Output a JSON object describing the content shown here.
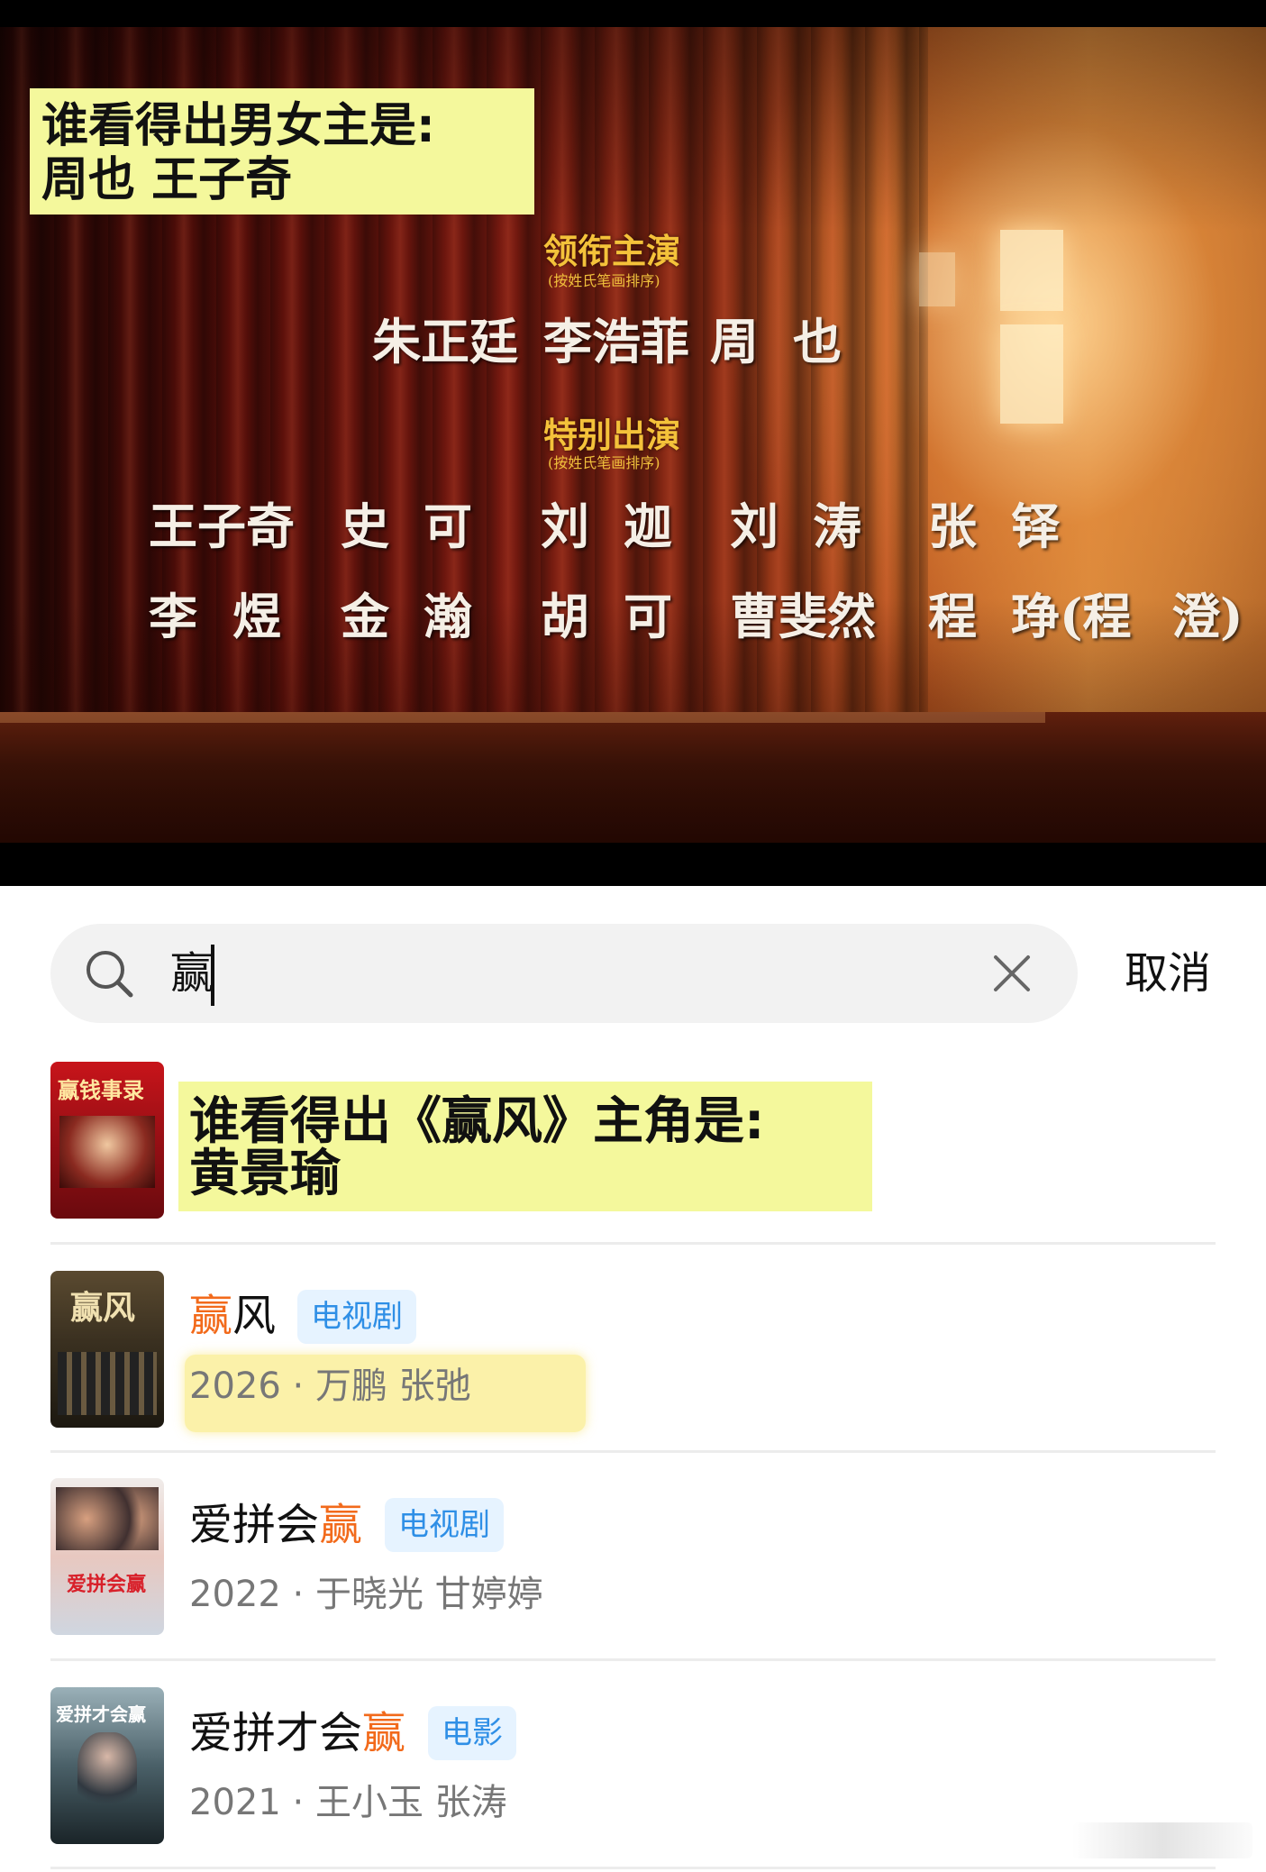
{
  "video": {
    "caption": {
      "line1": "谁看得出男女主是:",
      "line2": "周也 王子奇"
    },
    "credits": {
      "lead_heading": "领衔主演",
      "lead_note": "(按姓氏笔画排序)",
      "lead_names": [
        "朱正廷",
        "李浩菲",
        "周",
        "也"
      ],
      "special_heading": "特别出演",
      "special_note": "(按姓氏笔画排序)",
      "special_row1": [
        "王子奇",
        "史",
        "可",
        "刘",
        "迦",
        "刘",
        "涛",
        "张",
        "铎"
      ],
      "special_row2": [
        "李",
        "煜",
        "金",
        "瀚",
        "胡",
        "可",
        "曹斐然",
        "程",
        "琤(程",
        "澄)"
      ]
    }
  },
  "search": {
    "query": "赢",
    "clear_icon": "close-icon",
    "cancel_label": "取消"
  },
  "results": [
    {
      "poster_text": "赢钱事录",
      "highlight_line1": "谁看得出《赢风》主角是:",
      "highlight_line2": "黄景瑜"
    },
    {
      "poster_text": "赢风",
      "title_highlight": "赢",
      "title_rest": "风",
      "tag": "电视剧",
      "meta": "2026 · 万鹏 张弛"
    },
    {
      "poster_text": "爱拼会赢",
      "title_before": "爱拼会",
      "title_highlight": "赢",
      "tag": "电视剧",
      "meta": "2022 · 于晓光 甘婷婷"
    },
    {
      "poster_text": "爱拼才会赢",
      "title_before": "爱拼才会",
      "title_highlight": "赢",
      "tag": "电影",
      "meta": "2021 · 王小玉 张涛"
    }
  ],
  "colors": {
    "highlight_yellow": "#f4f89c",
    "keyword_orange": "#f26a1b",
    "tag_blue": "#2f8fe6",
    "tag_bg": "#e6f3ff",
    "credit_gold": "#f4c23a"
  }
}
